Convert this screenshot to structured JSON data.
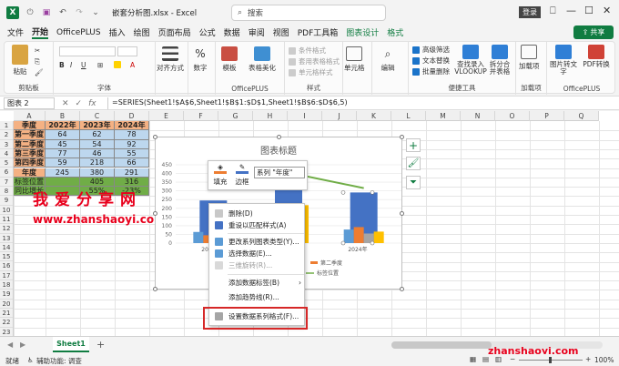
{
  "window": {
    "filename": "嵌套分析图.xlsx",
    "app": "Excel",
    "search_placeholder": "搜索",
    "login": "登录"
  },
  "menu": {
    "tabs": [
      "文件",
      "开始",
      "OfficePLUS",
      "插入",
      "绘图",
      "页面布局",
      "公式",
      "数据",
      "审阅",
      "视图",
      "PDF工具箱",
      "图表设计",
      "格式"
    ],
    "active": "开始",
    "share": "共享"
  },
  "ribbon": {
    "clipboard": {
      "paste": "粘贴",
      "label": "剪贴板"
    },
    "font": {
      "label": "字体"
    },
    "alignment": {
      "btn": "对齐方式"
    },
    "number": {
      "btn": "数字"
    },
    "officeplus1": {
      "template": "模板",
      "beautify": "表格美化",
      "label": "OfficePLUS"
    },
    "styles": {
      "cond": "条件格式",
      "table": "套用表格格式",
      "cell": "单元格样式",
      "label": "样式"
    },
    "cells": {
      "btn": "单元格"
    },
    "editing": {
      "btn": "编辑"
    },
    "tools": {
      "adv_filter": "高级筛选",
      "text_replace": "文本替换",
      "batch_delete": "批量删除",
      "vlookup": "查找录入 VLOOKUP",
      "split": "拆分合并表格",
      "label": "便捷工具"
    },
    "addins": {
      "btn": "加载项",
      "label": "加载项"
    },
    "officeplus2": {
      "img2text": "图片转文字",
      "pdf": "PDF转换",
      "label": "OfficePLUS"
    }
  },
  "formula_bar": {
    "name_box": "图表 2",
    "formula": "=SERIES(Sheet1!$A$6,Sheet1!$B$1:$D$1,Sheet1!$B$6:$D$6,5)"
  },
  "sheet": {
    "columns": [
      "A",
      "B",
      "C",
      "D",
      "E",
      "F",
      "G",
      "H",
      "I",
      "J",
      "K",
      "L",
      "M",
      "N",
      "O",
      "P",
      "Q"
    ],
    "rows": [
      "1",
      "2",
      "3",
      "4",
      "5",
      "6",
      "7",
      "8",
      "9",
      "10",
      "11",
      "12",
      "13",
      "14",
      "15",
      "16",
      "17",
      "18",
      "19",
      "20",
      "21",
      "22",
      "23"
    ],
    "table": {
      "header": [
        "季度",
        "2022年",
        "2023年",
        "2024年"
      ],
      "rows": [
        [
          "第一季度",
          "64",
          "62",
          "78"
        ],
        [
          "第二季度",
          "45",
          "54",
          "92"
        ],
        [
          "第三季度",
          "77",
          "46",
          "55"
        ],
        [
          "第四季度",
          "59",
          "218",
          "66"
        ],
        [
          "年度",
          "245",
          "380",
          "291"
        ],
        [
          "标签位置",
          "",
          "405",
          "316"
        ],
        [
          "同比增长",
          "",
          "55%",
          "-23%"
        ]
      ]
    }
  },
  "watermark": {
    "line1": "我爱分享网",
    "line2": "www.zhanshaoyi.com",
    "line3": "zhanshaoyi.com"
  },
  "chart_data": {
    "type": "bar",
    "title": "图表标题",
    "categories": [
      "2022年",
      "2023年",
      "2024年"
    ],
    "ylim": [
      0,
      450
    ],
    "yticks": [
      "0",
      "50",
      "100",
      "150",
      "200",
      "250",
      "300",
      "350",
      "400",
      "450"
    ],
    "series": [
      {
        "name": "第一季度",
        "values": [
          64,
          62,
          78
        ],
        "color": "#5b9bd5"
      },
      {
        "name": "第二季度",
        "values": [
          45,
          54,
          92
        ],
        "color": "#ed7d31"
      },
      {
        "name": "第三季度",
        "values": [
          77,
          46,
          55
        ],
        "color": "#a5a5a5"
      },
      {
        "name": "第四季度",
        "values": [
          59,
          218,
          66
        ],
        "color": "#ffc000"
      },
      {
        "name": "年度",
        "values": [
          245,
          380,
          291
        ],
        "color": "#4472c4"
      },
      {
        "name": "标签位置",
        "values": [
          null,
          405,
          316
        ],
        "color": "#70ad47",
        "kind": "line"
      }
    ],
    "visible_labels": {
      "x_last": "2024年",
      "x_first": "202",
      "legend_a": "第二季度",
      "legend_b": "标签位置"
    }
  },
  "mini_toolbar": {
    "fill": "填充",
    "border": "边框",
    "series": "系列 \"年度\""
  },
  "context_menu": {
    "items": [
      "删除(D)",
      "重设以匹配样式(A)",
      "更改系列图表类型(Y)...",
      "选择数据(E)...",
      "三维旋转(R)...",
      "添加数据标签(B)",
      "添加趋势线(R)...",
      "设置数据系列格式(F)..."
    ],
    "disabled_index": 4
  },
  "bottom": {
    "sheet_tab": "Sheet1",
    "add_sheet": "+",
    "status_ready": "就绪",
    "status_access": "辅助功能: 调查",
    "zoom": "100%"
  },
  "colors": {
    "accent": "#107c41",
    "highlight": "#d62828",
    "watermark": "#e8001c"
  }
}
